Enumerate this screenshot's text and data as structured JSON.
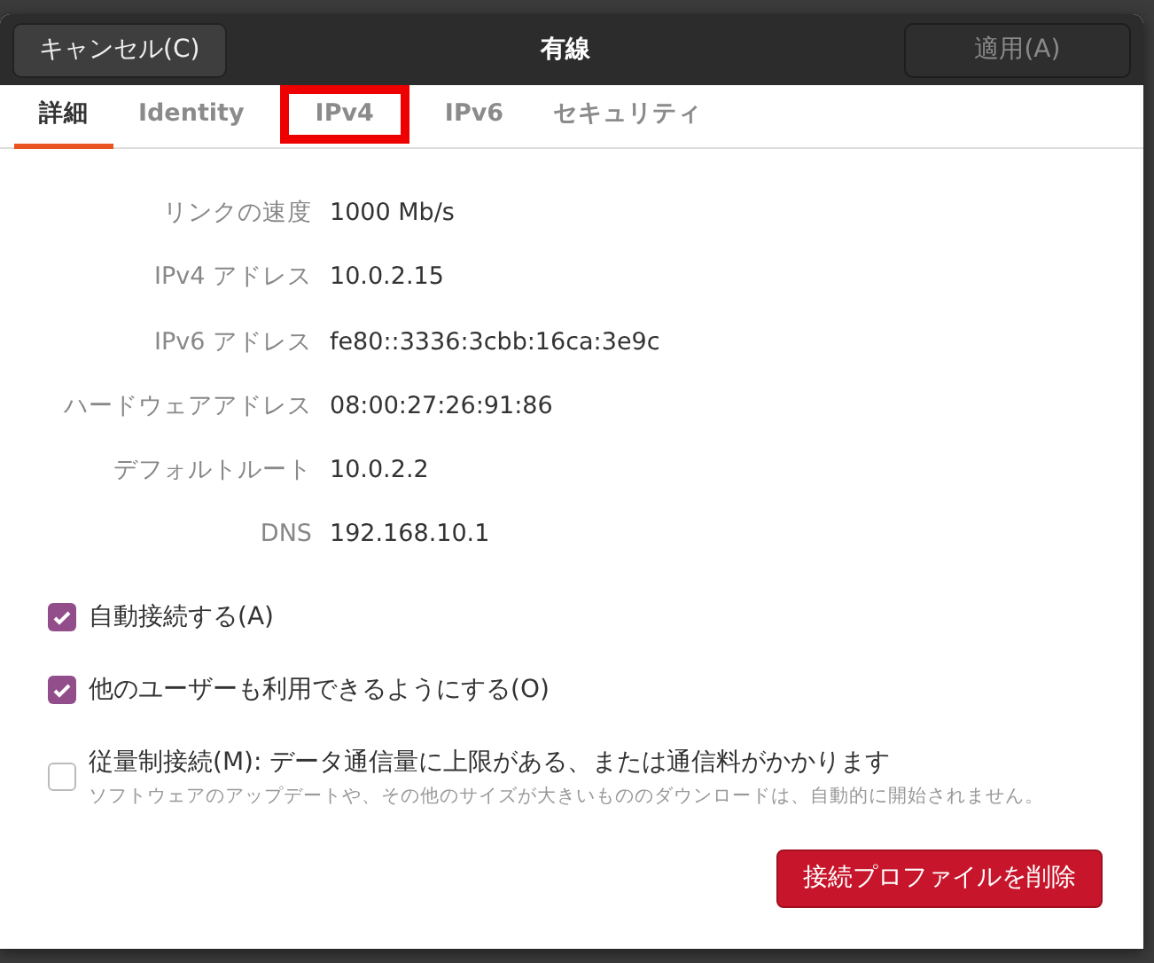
{
  "header": {
    "cancel": "キャンセル(C)",
    "title": "有線",
    "apply": "適用(A)",
    "apply_disabled": true
  },
  "tabs": [
    {
      "label": "詳細",
      "selected": true
    },
    {
      "label": "Identity",
      "selected": false,
      "highlighted": false
    },
    {
      "label": "IPv4",
      "selected": false,
      "highlighted": true
    },
    {
      "label": "IPv6",
      "selected": false,
      "highlighted": false
    },
    {
      "label": "セキュリティ",
      "selected": false,
      "highlighted": false
    }
  ],
  "details": [
    {
      "label": "リンクの速度",
      "value": "1000 Mb/s"
    },
    {
      "label": "IPv4 アドレス",
      "value": "10.0.2.15"
    },
    {
      "label": "IPv6 アドレス",
      "value": "fe80::3336:3cbb:16ca:3e9c"
    },
    {
      "label": "ハードウェアアドレス",
      "value": "08:00:27:26:91:86"
    },
    {
      "label": "デフォルトルート",
      "value": "10.0.2.2"
    },
    {
      "label": "DNS",
      "value": "192.168.10.1"
    }
  ],
  "options": [
    {
      "label": "自動接続する(A)",
      "checked": true
    },
    {
      "label": "他のユーザーも利用できるようにする(O)",
      "checked": true
    },
    {
      "label": "従量制接続(M): データ通信量に上限がある、または通信料がかかります",
      "description": "ソフトウェアのアップデートや、その他のサイズが大きいもののダウンロードは、自動的に開始されません。",
      "checked": false
    }
  ],
  "delete_button": "接続プロファイルを削除"
}
